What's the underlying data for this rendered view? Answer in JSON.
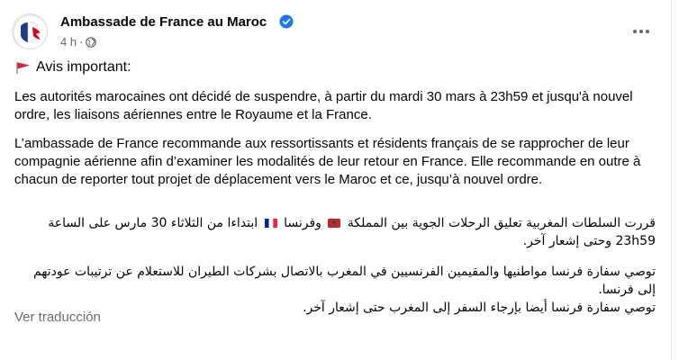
{
  "post": {
    "page_name": "Ambassade de France au Maroc",
    "time": "4 h",
    "separator": "·",
    "avis": "Avis important:",
    "paragraph_1": "Les autorités marocaines ont décidé de suspendre, à partir du mardi 30 mars à 23h59 et jusqu'à nouvel ordre, les liaisons aériennes entre le Royaume et la France.",
    "paragraph_2": "L’ambassade de France recommande aux ressortissants et résidents français de se rapprocher de leur compagnie aérienne afin d’examiner les modalités de leur retour en France. Elle recommande en outre à chacun de reporter tout projet de déplacement vers le Maroc et ce, jusqu’à nouvel ordre.",
    "arabic_1_part_1": "قررت السلطات المغربية تعليق الرحلات الجوية بين المملكة",
    "arabic_1_part_2": "وفرنسا",
    "arabic_1_part_3": "ابتداءا من الثلاثاء 30 مارس على الساعة 23h59 وحتى إشعار آخر.",
    "arabic_2_line_1": "توصي سفارة فرنسا مواطنيها والمقيمين الفرنسيين في المغرب بالاتصال بشركات الطيران للاستعلام عن ترتيبات عودتهم إلى فرنسا.",
    "arabic_2_line_2": "توصي سفارة فرنسا أيضا بإرجاء السفر إلى المغرب حتى إشعار آخر.",
    "see_translation": "Ver traducción"
  },
  "colors": {
    "text": "#050505",
    "secondary": "#65676b",
    "verified_blue": "#1877f2",
    "flag_red": "#e0202c"
  },
  "icons": {
    "verified": "verified-badge-icon",
    "globe": "globe-icon",
    "more": "more-options-icon",
    "flag": "triangular-flag-icon"
  }
}
